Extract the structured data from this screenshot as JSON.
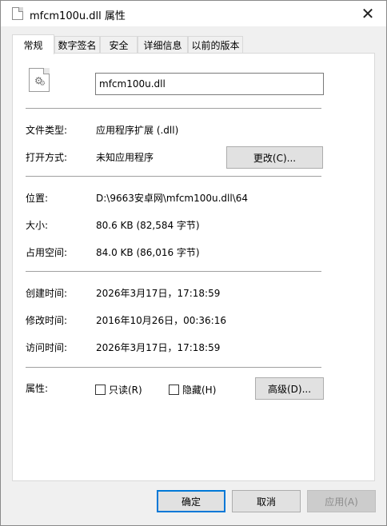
{
  "window": {
    "title": "mfcm100u.dll 属性",
    "close_glyph": "✕"
  },
  "tabs": [
    {
      "label": "常规",
      "active": true
    },
    {
      "label": "数字签名",
      "active": false
    },
    {
      "label": "安全",
      "active": false
    },
    {
      "label": "详细信息",
      "active": false
    },
    {
      "label": "以前的版本",
      "active": false
    }
  ],
  "general": {
    "file_name": "mfcm100u.dll",
    "file_type_label": "文件类型:",
    "file_type_value": "应用程序扩展 (.dll)",
    "open_with_label": "打开方式:",
    "open_with_value": "未知应用程序",
    "change_button": "更改(C)...",
    "location_label": "位置:",
    "location_value": "D:\\9663安卓网\\mfcm100u.dll\\64",
    "size_label": "大小:",
    "size_value": "80.6 KB (82,584 字节)",
    "size_on_disk_label": "占用空间:",
    "size_on_disk_value": "84.0 KB (86,016 字节)",
    "created_label": "创建时间:",
    "created_value": "2026年3月17日，17:18:59",
    "modified_label": "修改时间:",
    "modified_value": "2016年10月26日，00:36:16",
    "accessed_label": "访问时间:",
    "accessed_value": "2026年3月17日，17:18:59",
    "attributes_label": "属性:",
    "readonly_label": "只读(R)",
    "readonly_checked": false,
    "hidden_label": "隐藏(H)",
    "hidden_checked": false,
    "advanced_button": "高级(D)..."
  },
  "footer": {
    "ok": "确定",
    "cancel": "取消",
    "apply": "应用(A)"
  },
  "icons": {
    "title": "dll-file-icon",
    "file": "dll-settings-file-icon",
    "close": "close-icon"
  },
  "colors": {
    "accent": "#0078d7",
    "panel": "#ffffff",
    "window": "#f0f0f0"
  }
}
